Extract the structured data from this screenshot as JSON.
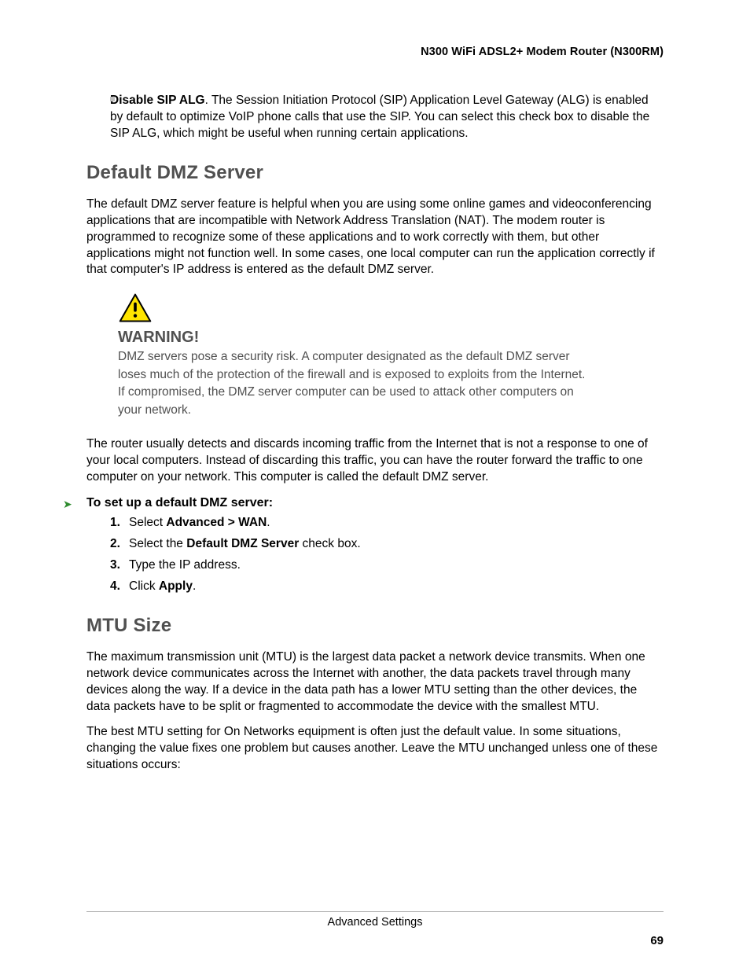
{
  "header": {
    "running_title": "N300 WiFi ADSL2+ Modem Router (N300RM)"
  },
  "intro": {
    "bullet_bold": "Disable SIP ALG",
    "bullet_rest": ". The Session Initiation Protocol (SIP) Application Level Gateway (ALG) is enabled by default to optimize VoIP phone calls that use the SIP. You can select this check box to disable the SIP ALG, which might be useful when running certain applications."
  },
  "dmz": {
    "heading": "Default DMZ Server",
    "para1": "The default DMZ server feature is helpful when you are using some online games and videoconferencing applications that are incompatible with Network Address Translation (NAT). The modem router is programmed to recognize some of these applications and to work correctly with them, but other applications might not function well. In some cases, one local computer can run the application correctly if that computer's IP address is entered as the default DMZ server.",
    "warning_title": "WARNING!",
    "warning_body": "DMZ servers pose a security risk. A computer designated as the default DMZ server loses much of the protection of the firewall and is exposed to exploits from the Internet. If compromised, the DMZ server computer can be used to attack other computers on your network.",
    "para2": "The router usually detects and discards incoming traffic from the Internet that is not a response to one of your local computers. Instead of discarding this traffic, you can have the router forward the traffic to one computer on your network. This computer is called the default DMZ server.",
    "procedure_title": "To set up a default DMZ server:",
    "steps": {
      "s1_before": "Select ",
      "s1_bold": "Advanced > WAN",
      "s1_after": ".",
      "s2_before": "Select the ",
      "s2_bold": "Default DMZ Server",
      "s2_after": " check box.",
      "s3": "Type the IP address.",
      "s4_before": "Click ",
      "s4_bold": "Apply",
      "s4_after": "."
    }
  },
  "mtu": {
    "heading": "MTU Size",
    "para1": "The maximum transmission unit (MTU) is the largest data packet a network device transmits. When one network device communicates across the Internet with another, the data packets travel through many devices along the way. If a device in the data path has a lower MTU setting than the other devices, the data packets have to be split or fragmented to accommodate the device with the smallest MTU.",
    "para2": "The best MTU setting for On Networks equipment is often just the default value. In some situations, changing the value fixes one problem but causes another. Leave the MTU unchanged unless one of these situations occurs:"
  },
  "footer": {
    "chapter": "Advanced Settings",
    "pagenum": "69"
  }
}
